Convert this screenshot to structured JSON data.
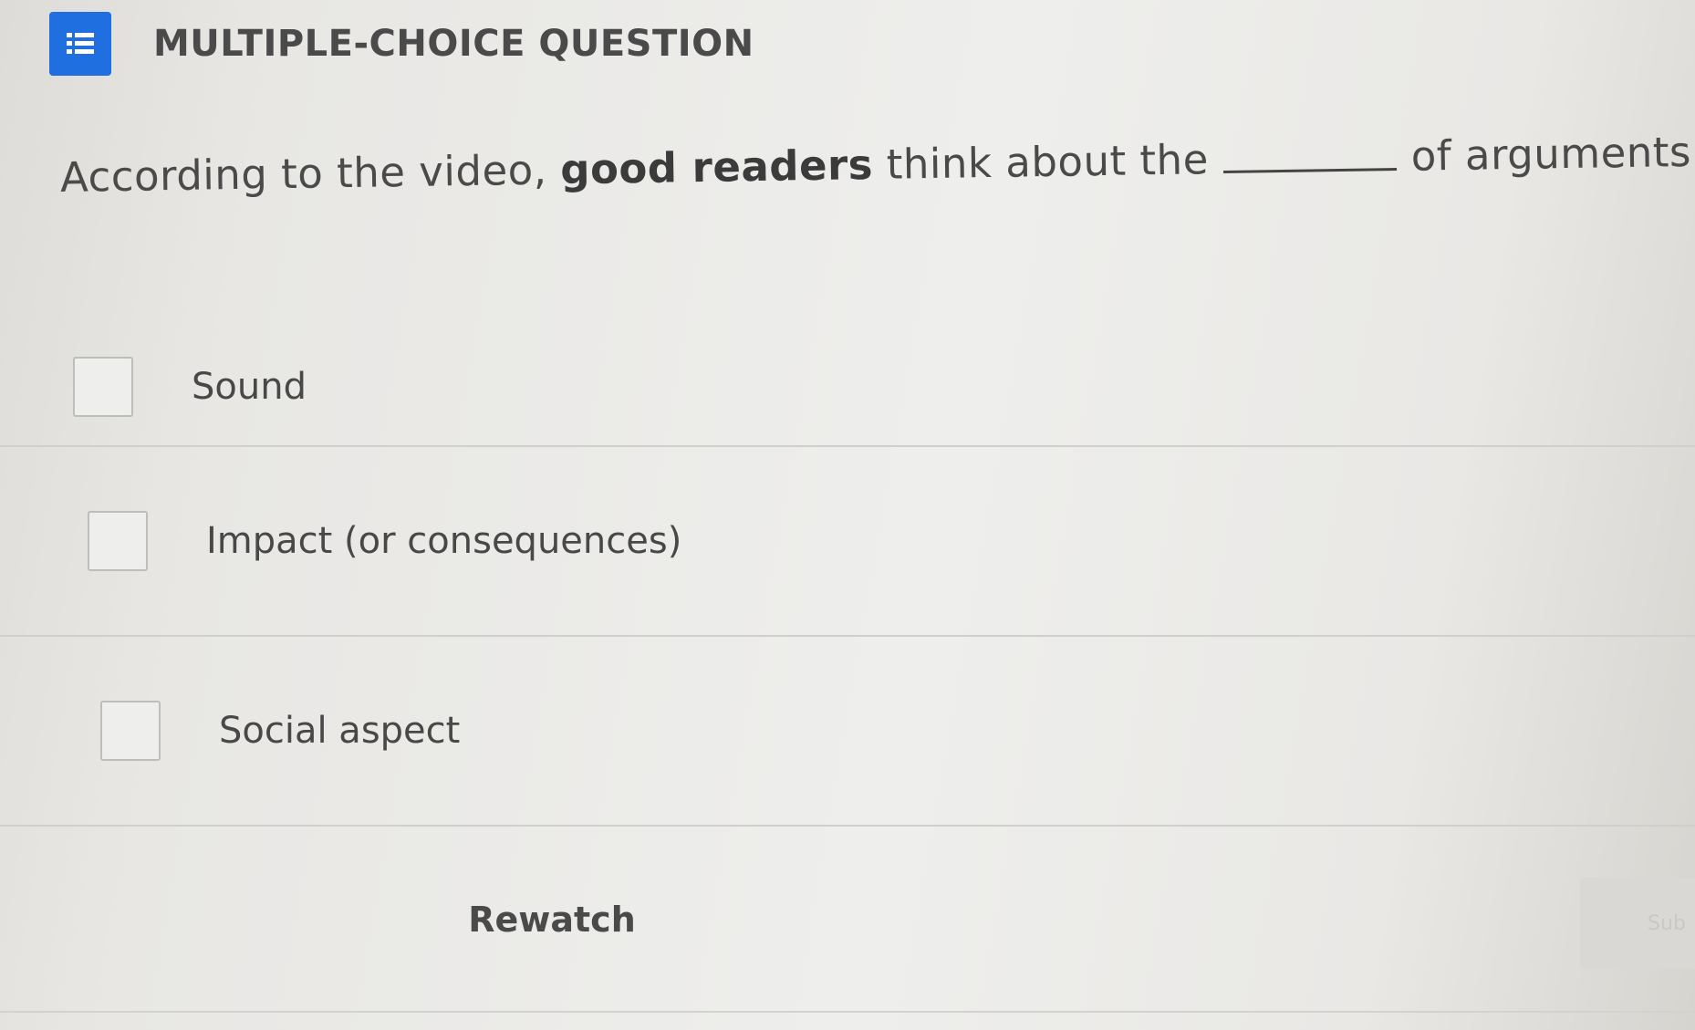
{
  "header": {
    "type_label": "MULTIPLE-CHOICE QUESTION",
    "badge_color": "#1f6fe0",
    "icon": "list-icon"
  },
  "question": {
    "prefix": "According to the video, ",
    "bold": "good readers",
    "middle": " think about the",
    "suffix": "of arguments."
  },
  "options": [
    {
      "label": "Sound",
      "checked": false
    },
    {
      "label": "Impact (or consequences)",
      "checked": false
    },
    {
      "label": "Social aspect",
      "checked": false
    }
  ],
  "footer": {
    "rewatch_label": "Rewatch",
    "submit_label": "Sub"
  }
}
